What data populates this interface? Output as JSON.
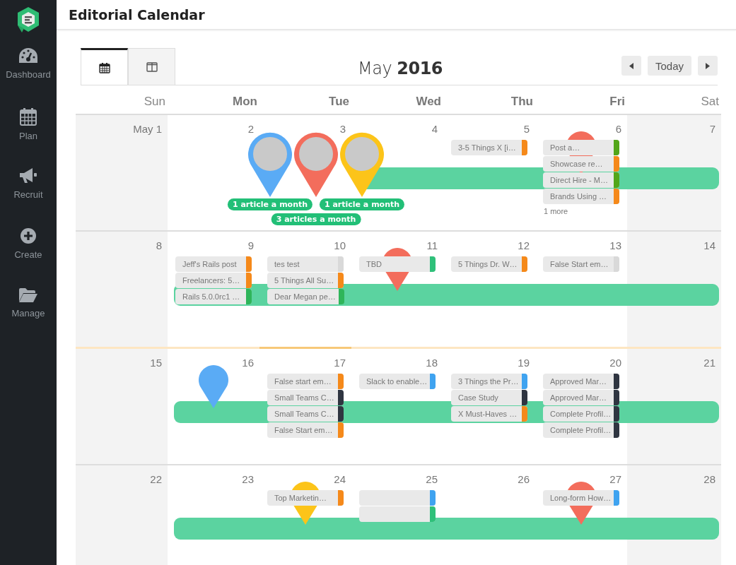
{
  "sidebar": {
    "items": [
      {
        "label": "Dashboard"
      },
      {
        "label": "Plan"
      },
      {
        "label": "Recruit"
      },
      {
        "label": "Create"
      },
      {
        "label": "Manage"
      }
    ]
  },
  "header": {
    "title": "Editorial Calendar"
  },
  "toolbar": {
    "views": [
      {
        "selected": true
      },
      {
        "selected": false
      }
    ],
    "month": "May",
    "year": "2016",
    "today_button": "Today"
  },
  "calendar": {
    "columns": [
      {
        "label": "Sun",
        "weekend": true
      },
      {
        "label": "Mon",
        "weekend": false
      },
      {
        "label": "Tue",
        "weekend": false
      },
      {
        "label": "Wed",
        "weekend": false
      },
      {
        "label": "Thu",
        "weekend": false
      },
      {
        "label": "Fri",
        "weekend": false
      },
      {
        "label": "Sat",
        "weekend": true
      }
    ],
    "weeks": [
      {
        "days": [
          {
            "date": "May 1",
            "today": false
          },
          {
            "date": "2",
            "today": false
          },
          {
            "date": "3",
            "today": false,
            "pins": [
              {
                "kind": "avatar",
                "color": "#5aabf5",
                "badge": "**1** article a month"
              },
              {
                "kind": "avatar",
                "color": "#f36d5c",
                "badge": "**3** articles a month"
              }
            ]
          },
          {
            "date": "4",
            "today": false,
            "pins": [
              {
                "kind": "avatar",
                "color": "#fcc419",
                "badge": "**1** article a month"
              }
            ]
          },
          {
            "date": "5",
            "today": false,
            "events": [
              {
                "title": "3-5 Things X [i…",
                "color": "#f5891a"
              }
            ]
          },
          {
            "date": "6",
            "today": false,
            "events": [
              {
                "title": "Post a…",
                "color": "#52a619"
              },
              {
                "title": "Showcase re…",
                "color": "#f5891a"
              },
              {
                "title": "Direct Hire - M…",
                "color": "#52a619"
              },
              {
                "title": "Brands Using …",
                "color": "#f5891a"
              }
            ],
            "more": "1 more",
            "pins": [
              {
                "kind": "plain",
                "color": "#f36d5c"
              }
            ]
          },
          {
            "date": "7",
            "today": false
          }
        ]
      },
      {
        "days": [
          {
            "date": "8",
            "today": false
          },
          {
            "date": "9",
            "today": false,
            "events": [
              {
                "title": "Jeff's Rails post",
                "color": "#f5891a"
              },
              {
                "title": "Freelancers: 5…",
                "color": "#f5891a"
              },
              {
                "title": "Rails 5.0.0rc1 …",
                "color": "#2fb55a"
              }
            ]
          },
          {
            "date": "10",
            "today": false,
            "events": [
              {
                "title": "tes test",
                "color": "#d9d9d9"
              },
              {
                "title": "5 Things All Su…",
                "color": "#f5891a"
              },
              {
                "title": "Dear Megan pe…",
                "color": "#2fb55a"
              }
            ]
          },
          {
            "date": "11",
            "today": false,
            "events": [
              {
                "title": "TBD",
                "color": "#2fc07a"
              }
            ],
            "pins": [
              {
                "kind": "plain",
                "color": "#f36d5c"
              }
            ]
          },
          {
            "date": "12",
            "today": false,
            "events": [
              {
                "title": "5 Things Dr. W…",
                "color": "#f5891a"
              }
            ]
          },
          {
            "date": "13",
            "today": false,
            "events": [
              {
                "title": "False Start em…",
                "color": "#d9d9d9"
              }
            ]
          },
          {
            "date": "14",
            "today": false
          }
        ]
      },
      {
        "days": [
          {
            "date": "15",
            "today": false
          },
          {
            "date": "16",
            "today": false,
            "pins": [
              {
                "kind": "plain",
                "color": "#5aabf5"
              }
            ]
          },
          {
            "date": "17",
            "today": true,
            "events": [
              {
                "title": "False start em…",
                "color": "#f5891a"
              },
              {
                "title": "Small Teams C…",
                "color": "#2f3541"
              },
              {
                "title": "Small Teams C…",
                "color": "#2f3541"
              },
              {
                "title": "False Start em…",
                "color": "#f5891a"
              }
            ]
          },
          {
            "date": "18",
            "today": false,
            "events": [
              {
                "title": "Slack to enable…",
                "color": "#3fa3f0"
              }
            ]
          },
          {
            "date": "19",
            "today": false,
            "events": [
              {
                "title": "3 Things the Pr…",
                "color": "#3fa3f0"
              },
              {
                "title": "Case Study",
                "color": "#2f3541"
              },
              {
                "title": "X Must-Haves …",
                "color": "#f5891a"
              }
            ]
          },
          {
            "date": "20",
            "today": false,
            "events": [
              {
                "title": "Approved Mar…",
                "color": "#2f3541"
              },
              {
                "title": "Approved Mar…",
                "color": "#2f3541"
              },
              {
                "title": "Complete Profil…",
                "color": "#2f3541"
              },
              {
                "title": "Complete Profil…",
                "color": "#2f3541"
              }
            ]
          },
          {
            "date": "21",
            "today": false
          }
        ]
      },
      {
        "days": [
          {
            "date": "22",
            "today": false
          },
          {
            "date": "23",
            "today": false
          },
          {
            "date": "24",
            "today": false,
            "events": [
              {
                "title": "Top Marketin…",
                "color": "#f5891a"
              }
            ],
            "pins": [
              {
                "kind": "plain",
                "color": "#fcc419"
              }
            ]
          },
          {
            "date": "25",
            "today": false,
            "events": [
              {
                "color": "#3fa3f0"
              },
              {
                "color": "#2fc07a"
              }
            ]
          },
          {
            "date": "26",
            "today": false
          },
          {
            "date": "27",
            "today": false,
            "events": [
              {
                "title": "Long-form How…",
                "color": "#3fa3f0"
              }
            ],
            "pins": [
              {
                "kind": "plain",
                "color": "#f36d5c"
              }
            ]
          },
          {
            "date": "28",
            "today": false
          }
        ]
      }
    ]
  }
}
